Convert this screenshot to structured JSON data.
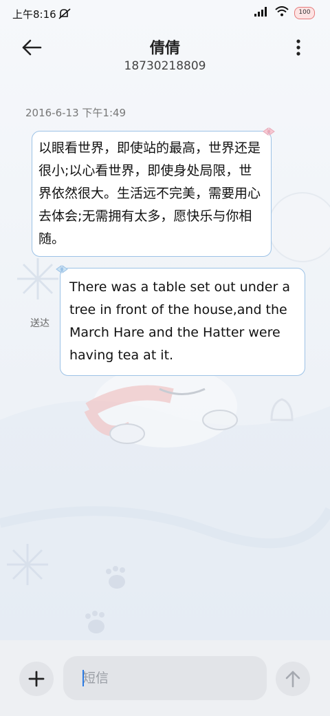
{
  "status_bar": {
    "time": "上午8:16",
    "battery": "100"
  },
  "header": {
    "contact_name": "倩倩",
    "contact_number": "18730218809"
  },
  "conversation": {
    "timestamp": "2016-6-13 下午1:49",
    "messages": [
      {
        "direction": "received",
        "text": "以眼看世界，即使站的最高，世界还是很小;以心看世界，即使身处局限，世界依然很大。生活远不完美，需要用心去体会;无需拥有太多，愿快乐与你相随。"
      },
      {
        "direction": "sent",
        "text": "There was a table set out under a tree in front of the house,and the March Hare and the Hatter were having tea at it.",
        "status": "送达"
      }
    ]
  },
  "composer": {
    "placeholder": "短信"
  },
  "colors": {
    "bubble_border": "#9cc2e6",
    "cursor": "#2b7be4"
  }
}
